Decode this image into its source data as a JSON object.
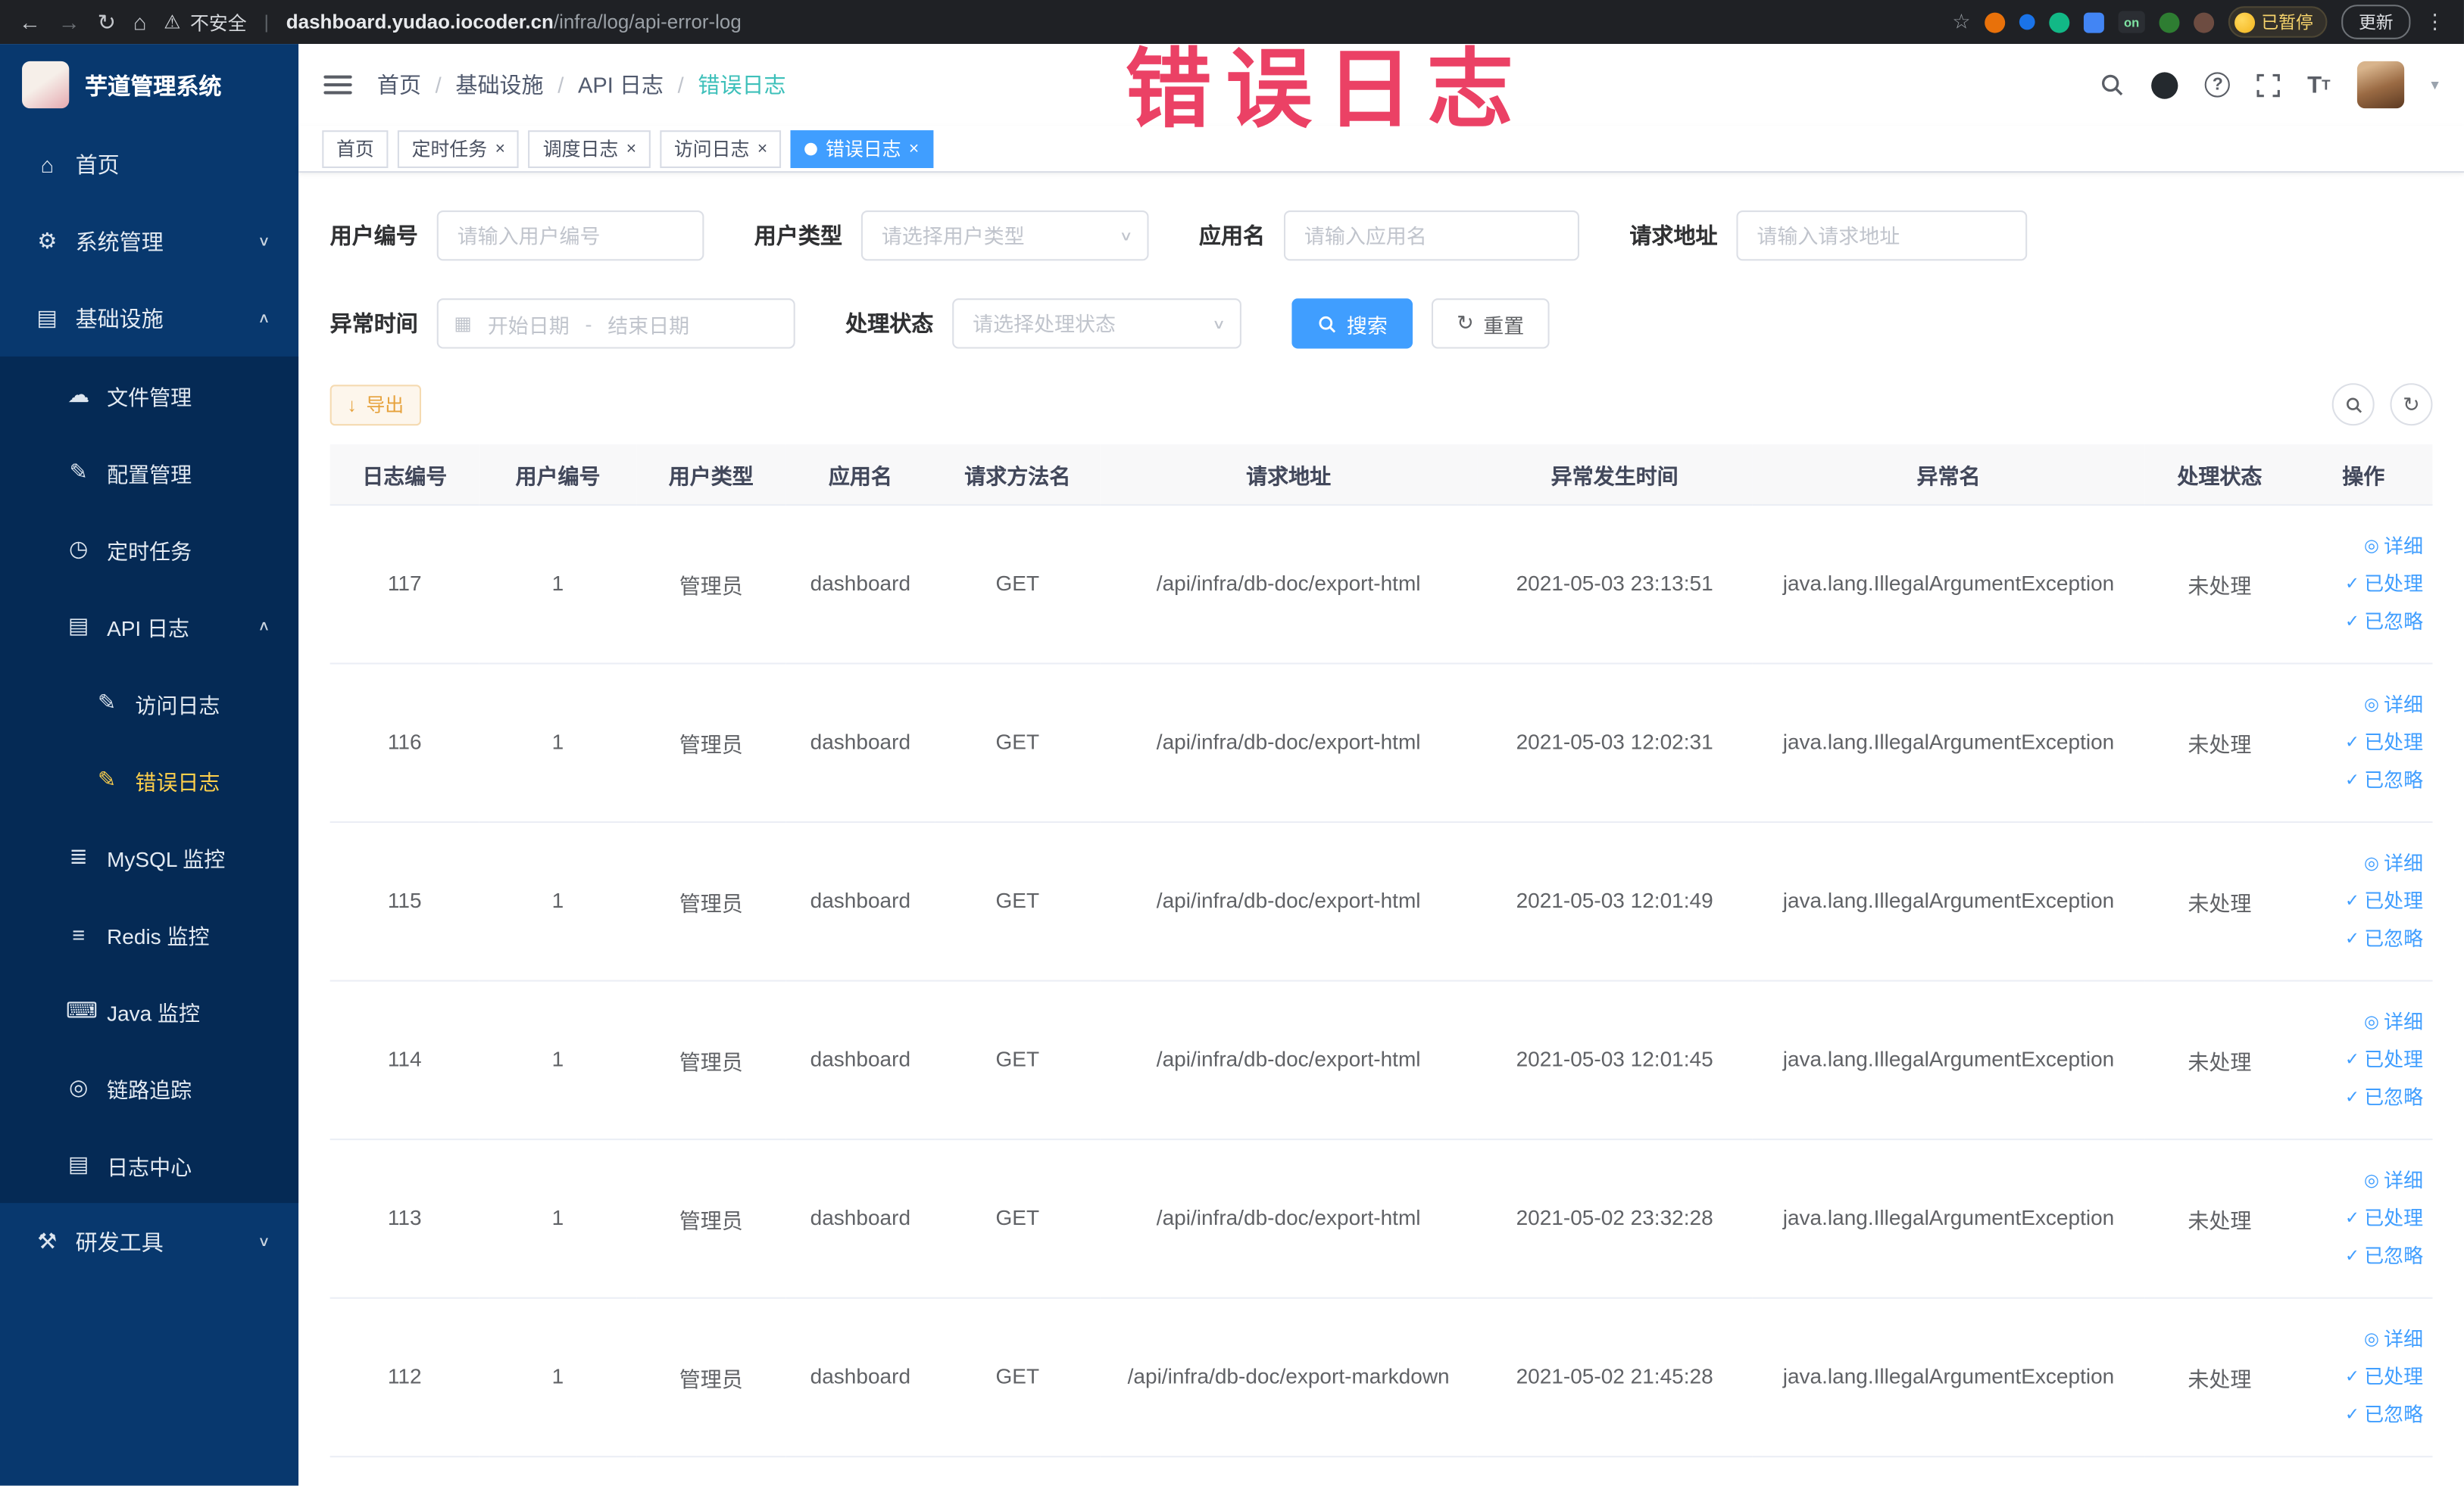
{
  "colors": {
    "primary": "#409eff",
    "menu_active": "#ffd04b",
    "warning": "#e6a23c",
    "annotation": "#eb4165",
    "sidebar_bg": "#08386e"
  },
  "glyphs": {
    "back": "←",
    "forward": "→",
    "reload": "↻",
    "home": "⌂",
    "warning": "⚠",
    "star": "☆",
    "menu_dots": "⋮",
    "chevron_down": "∨",
    "chevron_up": "∧",
    "close": "×",
    "slash": "/",
    "check": "✓",
    "view": "◎",
    "refresh": "↻",
    "download": "↓",
    "calendar": "▦",
    "caret_down": "▾",
    "help": "?",
    "font_big": "T",
    "font_small": "T"
  },
  "annotation": {
    "text": "错误日志"
  },
  "browser": {
    "warning_text": "不安全",
    "url_host": "dashboard.yudao.iocoder.cn",
    "url_path": "/infra/log/api-error-log",
    "extension_on_label": "on",
    "paused_label": "已暂停",
    "update_label": "更新"
  },
  "sidebar": {
    "logo_title": "芋道管理系统",
    "items": [
      {
        "label": "首页",
        "icon": "⌂"
      },
      {
        "label": "系统管理",
        "icon": "⚙"
      },
      {
        "label": "基础设施",
        "icon": "▤"
      },
      {
        "label": "文件管理",
        "icon": "☁"
      },
      {
        "label": "配置管理",
        "icon": "✎"
      },
      {
        "label": "定时任务",
        "icon": "◷"
      },
      {
        "label": "API 日志",
        "icon": "▤"
      },
      {
        "label": "访问日志",
        "icon": "✎"
      },
      {
        "label": "错误日志",
        "icon": "✎"
      },
      {
        "label": "MySQL 监控",
        "icon": "≣"
      },
      {
        "label": "Redis 监控",
        "icon": "≡"
      },
      {
        "label": "Java 监控",
        "icon": "⌨"
      },
      {
        "label": "链路追踪",
        "icon": "◎"
      },
      {
        "label": "日志中心",
        "icon": "▤"
      },
      {
        "label": "研发工具",
        "icon": "⚒"
      }
    ]
  },
  "breadcrumbs": [
    "首页",
    "基础设施",
    "API 日志",
    "错误日志"
  ],
  "tags": [
    {
      "label": "首页"
    },
    {
      "label": "定时任务"
    },
    {
      "label": "调度日志"
    },
    {
      "label": "访问日志"
    },
    {
      "label": "错误日志"
    }
  ],
  "filters": {
    "user_id_label": "用户编号",
    "user_id_placeholder": "请输入用户编号",
    "user_type_label": "用户类型",
    "user_type_placeholder": "请选择用户类型",
    "app_label": "应用名",
    "app_placeholder": "请输入应用名",
    "url_label": "请求地址",
    "url_placeholder": "请输入请求地址",
    "time_label": "异常时间",
    "time_start_placeholder": "开始日期",
    "time_separator": "-",
    "time_end_placeholder": "结束日期",
    "status_label": "处理状态",
    "status_placeholder": "请选择处理状态",
    "search_button": "搜索",
    "reset_button": "重置"
  },
  "toolbar": {
    "export_label": "导出"
  },
  "row_actions": {
    "detail": "详细",
    "processed": "已处理",
    "ignored": "已忽略"
  },
  "table": {
    "columns": [
      "日志编号",
      "用户编号",
      "用户类型",
      "应用名",
      "请求方法名",
      "请求地址",
      "异常发生时间",
      "异常名",
      "处理状态",
      "操作"
    ],
    "rows": [
      {
        "id": 117,
        "user_id": 1,
        "user_type": "管理员",
        "app": "dashboard",
        "method": "GET",
        "url": "/api/infra/db-doc/export-html",
        "time": "2021-05-03 23:13:51",
        "exception": "java.lang.IllegalArgumentException",
        "status": "未处理"
      },
      {
        "id": 116,
        "user_id": 1,
        "user_type": "管理员",
        "app": "dashboard",
        "method": "GET",
        "url": "/api/infra/db-doc/export-html",
        "time": "2021-05-03 12:02:31",
        "exception": "java.lang.IllegalArgumentException",
        "status": "未处理"
      },
      {
        "id": 115,
        "user_id": 1,
        "user_type": "管理员",
        "app": "dashboard",
        "method": "GET",
        "url": "/api/infra/db-doc/export-html",
        "time": "2021-05-03 12:01:49",
        "exception": "java.lang.IllegalArgumentException",
        "status": "未处理"
      },
      {
        "id": 114,
        "user_id": 1,
        "user_type": "管理员",
        "app": "dashboard",
        "method": "GET",
        "url": "/api/infra/db-doc/export-html",
        "time": "2021-05-03 12:01:45",
        "exception": "java.lang.IllegalArgumentException",
        "status": "未处理"
      },
      {
        "id": 113,
        "user_id": 1,
        "user_type": "管理员",
        "app": "dashboard",
        "method": "GET",
        "url": "/api/infra/db-doc/export-html",
        "time": "2021-05-02 23:32:28",
        "exception": "java.lang.IllegalArgumentException",
        "status": "未处理"
      },
      {
        "id": 112,
        "user_id": 1,
        "user_type": "管理员",
        "app": "dashboard",
        "method": "GET",
        "url": "/api/infra/db-doc/export-markdown",
        "time": "2021-05-02 21:45:28",
        "exception": "java.lang.IllegalArgumentException",
        "status": "未处理"
      }
    ]
  }
}
